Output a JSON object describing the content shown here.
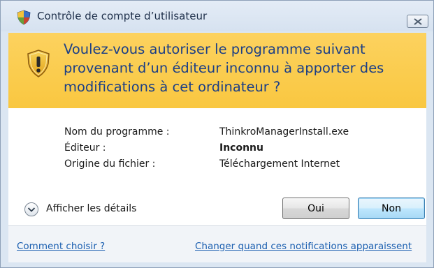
{
  "window": {
    "title": "Contrôle de compte d’utilisateur",
    "close_glyph": "✕"
  },
  "banner": {
    "question": "Voulez-vous autoriser le programme suivant provenant d’un éditeur inconnu à apporter des modifications à cet ordinateur ?",
    "icon": "warning-shield-icon"
  },
  "info": {
    "rows": [
      {
        "label": "Nom du programme :",
        "value": "ThinkroManagerInstall.exe",
        "bold": false
      },
      {
        "label": "Éditeur :",
        "value": "Inconnu",
        "bold": true
      },
      {
        "label": "Origine du fichier :",
        "value": "Téléchargement Internet",
        "bold": false
      }
    ]
  },
  "actions": {
    "details_label": "Afficher les détails",
    "yes_label": "Oui",
    "no_label": "Non"
  },
  "footer": {
    "help_link": "Comment choisir ?",
    "settings_link": "Changer quand ces notifications apparaissent"
  },
  "colors": {
    "banner": "#f9c740",
    "banner_text": "#1c3f86",
    "link": "#1b5fb0"
  }
}
